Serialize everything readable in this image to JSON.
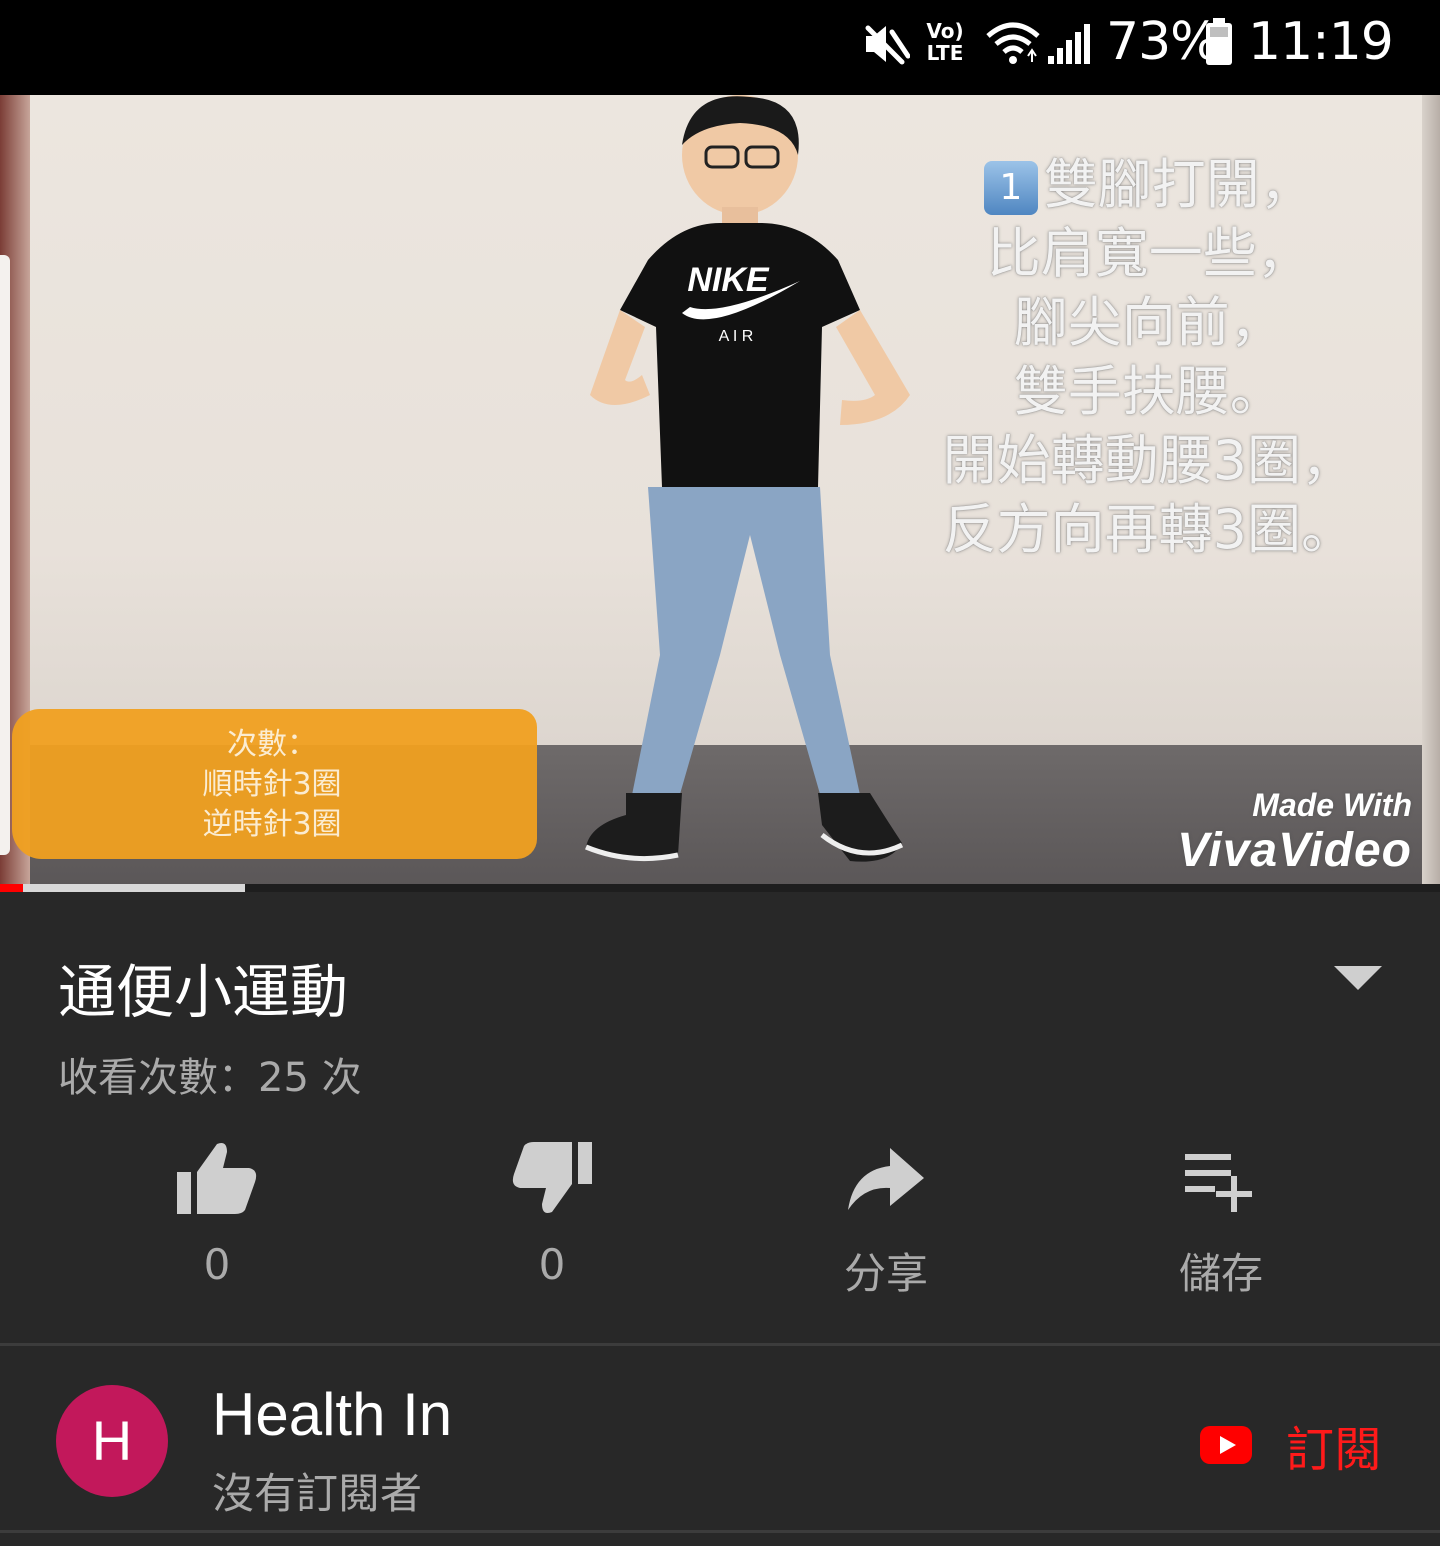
{
  "status_bar": {
    "battery_percent": "73%",
    "time": "11:19",
    "icons": [
      "mute-icon",
      "volte-icon",
      "wifi-icon",
      "signal-icon",
      "battery-icon"
    ],
    "volte_top": "Vo)",
    "volte_bottom": "LTE"
  },
  "video": {
    "instruction_number": "1",
    "instruction_lines": "雙腳打開，\n比肩寬一些，\n腳尖向前，\n雙手扶腰。\n開始轉動腰3圈，\n反方向再轉3圈。",
    "count_box_text": "次數：\n順時針3圈\n逆時針3圈",
    "watermark_line1": "Made With",
    "watermark_line2": "VivaVideo",
    "shirt_logo": "NIKE",
    "shirt_sub": "A I R",
    "progress_played": 0.016,
    "progress_buffered": 0.17
  },
  "info": {
    "title": "通便小運動",
    "views": "收看次數：25 次"
  },
  "actions": [
    {
      "icon": "thumbs-up-icon",
      "label": "0"
    },
    {
      "icon": "thumbs-down-icon",
      "label": "0"
    },
    {
      "icon": "share-icon",
      "label": "分享"
    },
    {
      "icon": "add-to-playlist-icon",
      "label": "儲存"
    }
  ],
  "channel": {
    "avatar_letter": "H",
    "name": "Health In",
    "subscribers": "沒有訂閱者",
    "subscribe_label": "訂閱"
  },
  "colors": {
    "background": "#282828",
    "accent_red": "#ff0000",
    "avatar": "#c2185b",
    "secondary_text": "#aaaaaa"
  }
}
